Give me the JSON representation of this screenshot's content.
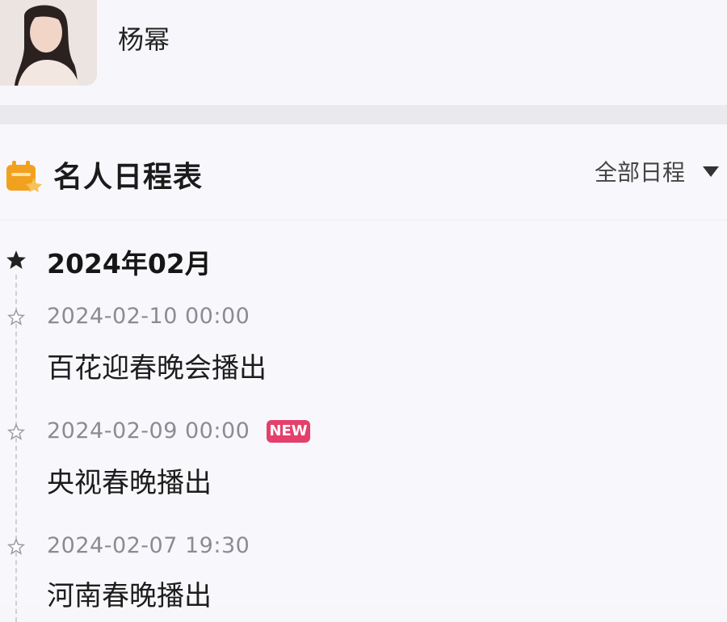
{
  "profile": {
    "name": "杨幂"
  },
  "schedule": {
    "title": "名人日程表",
    "filter_label": "全部日程",
    "month": "2024年02月",
    "events": [
      {
        "time": "2024-02-10 00:00",
        "title": "百花迎春晚会播出",
        "badge": ""
      },
      {
        "time": "2024-02-09 00:00",
        "title": "央视春晚播出",
        "badge": "NEW"
      },
      {
        "time": "2024-02-07 19:30",
        "title": "河南春晚播出",
        "badge": ""
      }
    ]
  },
  "colors": {
    "accent_orange": "#f2a11e",
    "badge_pink": "#e53f6b",
    "text_muted": "#8b8b92"
  },
  "icons": {
    "calendar": "calendar-icon",
    "month_marker": "star-filled-icon",
    "event_marker": "star-outline-icon",
    "dropdown": "triangle-down-icon"
  }
}
